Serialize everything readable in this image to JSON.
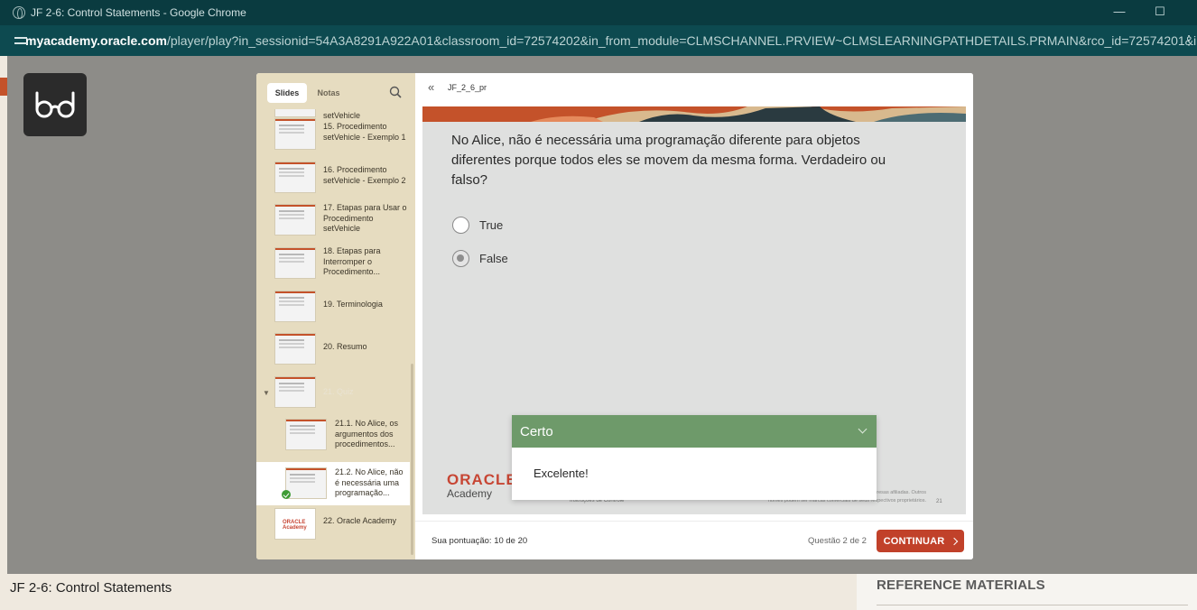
{
  "browser": {
    "window_title": "JF 2-6: Control Statements - Google Chrome",
    "url_host": "myacademy.oracle.com",
    "url_rest": "/player/play?in_sessionid=54A3A8291A922A01&classroom_id=72574202&in_from_module=CLMSCHANNEL.PRVIEW~CLMSLEARNINGPATHDETAILS.PRMAIN&rco_id=72574201&in..."
  },
  "page": {
    "title": "JF 2-6: Control Statements",
    "reference_title": "REFERENCE MATERIALS"
  },
  "sidebar": {
    "tabs": [
      "Slides",
      "Notas"
    ],
    "items": [
      {
        "label": "setVehicle"
      },
      {
        "label": "15. Procedimento setVehicle - Exemplo 1"
      },
      {
        "label": "16. Procedimento setVehicle - Exemplo 2"
      },
      {
        "label": "17. Etapas para Usar o Procedimento setVehicle"
      },
      {
        "label": "18. Etapas para Interromper o Procedimento..."
      },
      {
        "label": "19. Terminologia"
      },
      {
        "label": "20. Resumo"
      },
      {
        "label": "21. Quiz"
      },
      {
        "label": "21.1.  No Alice, os argumentos dos procedimentos..."
      },
      {
        "label": "21.2.  No Alice, não é necessária uma programação..."
      },
      {
        "label": "22. Oracle Academy"
      }
    ],
    "oracle_thumb_text": "ORACLE Academy"
  },
  "player": {
    "breadcrumb": "JF_2_6_pr",
    "question": "No Alice, não é necessária uma programação diferente para objetos diferentes porque todos eles se movem da mesma forma. Verdadeiro ou falso?",
    "options": [
      {
        "label": "True",
        "selected": false
      },
      {
        "label": "False",
        "selected": true
      }
    ],
    "slide_logo": "ORACLE",
    "slide_academy": "Academy",
    "slide_footer": "Instruções de Controle",
    "slide_legal": "MySQL são marcas comerciais registradas da Oracle Corporation e/ou de suas empresas afiliadas. Outros nomes podem ser marcas comerciais de seus respectivos proprietários.",
    "slide_number": "21",
    "feedback_title": "Certo",
    "feedback_body": "Excelente!",
    "score": "Sua pontuação: 10 de 20",
    "question_count": "Questão 2 de 2",
    "continue_label": "CONTINUAR"
  },
  "colors": {
    "chrome_dark": "#0a3b40",
    "accent_orange": "#c4522a",
    "feedback_green": "#6e9a6a",
    "sidebar_bg": "#e6dcc0"
  }
}
